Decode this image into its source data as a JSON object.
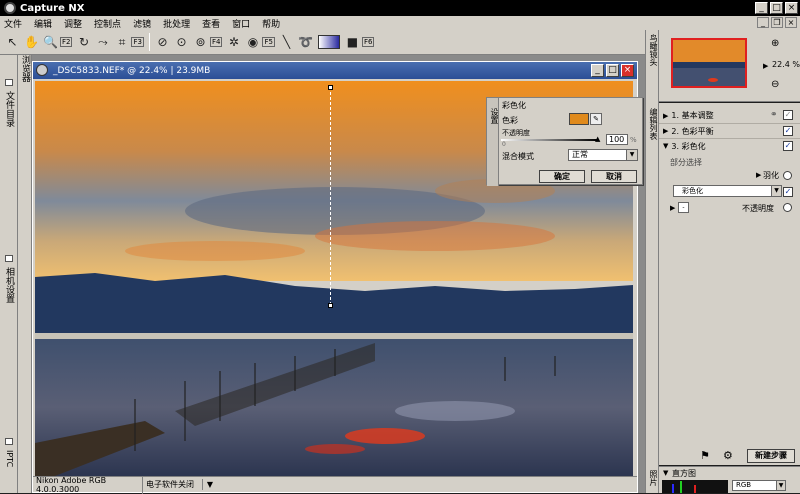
{
  "app": {
    "title": "Capture NX"
  },
  "menu": [
    "文件",
    "编辑",
    "调整",
    "控制点",
    "滤镜",
    "批处理",
    "查看",
    "窗口",
    "帮助"
  ],
  "toolbar": {
    "keys": [
      "F2",
      "F3",
      "F4",
      "F5",
      "F6"
    ]
  },
  "left_panel": {
    "tab1": "浏览器",
    "tab2": "文件目录",
    "tab3": "相机设置",
    "tab4": "IPTC"
  },
  "document": {
    "title": "_DSC5833.NEF* @ 22.4% | 23.9MB",
    "profile": "Nikon Adobe RGB 4.0.0.3000",
    "status": "电子软件关闭"
  },
  "colorize": {
    "title": "彩色化",
    "side": "设置",
    "color_label": "色彩",
    "color_value": "#e08a1c",
    "opacity_label": "不透明度",
    "opacity_min": "0",
    "opacity_value": "100",
    "opacity_unit": "%",
    "blend_label": "混合模式",
    "blend_value": "正常",
    "ok_label": "确定",
    "cancel_label": "取消"
  },
  "navigator": {
    "title": "鸟瞰镜头",
    "zoom": "22.4 %"
  },
  "edit_list": {
    "title": "编辑列表",
    "steps": [
      {
        "label": "1. 基本调整",
        "checked": true
      },
      {
        "label": "2. 色彩平衡",
        "checked": true
      },
      {
        "label": "3. 彩色化",
        "checked": true
      }
    ],
    "partial_selection": "部分选择",
    "feather": "羽化",
    "colorize_item": "彩色化",
    "opacity_item": "不透明度",
    "new_step": "新建步骤"
  },
  "histogram": {
    "title": "直方图",
    "channel": "RGB",
    "side": "照片"
  }
}
